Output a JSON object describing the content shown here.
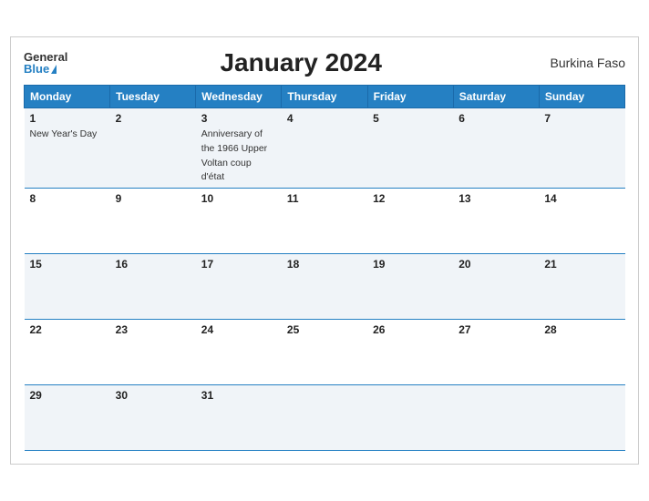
{
  "header": {
    "logo_general": "General",
    "logo_blue": "Blue",
    "month_title": "January 2024",
    "country": "Burkina Faso"
  },
  "days_of_week": [
    "Monday",
    "Tuesday",
    "Wednesday",
    "Thursday",
    "Friday",
    "Saturday",
    "Sunday"
  ],
  "weeks": [
    [
      {
        "day": "1",
        "event": "New Year's Day"
      },
      {
        "day": "2",
        "event": ""
      },
      {
        "day": "3",
        "event": "Anniversary of the 1966 Upper Voltan coup d'état"
      },
      {
        "day": "4",
        "event": ""
      },
      {
        "day": "5",
        "event": ""
      },
      {
        "day": "6",
        "event": ""
      },
      {
        "day": "7",
        "event": ""
      }
    ],
    [
      {
        "day": "8",
        "event": ""
      },
      {
        "day": "9",
        "event": ""
      },
      {
        "day": "10",
        "event": ""
      },
      {
        "day": "11",
        "event": ""
      },
      {
        "day": "12",
        "event": ""
      },
      {
        "day": "13",
        "event": ""
      },
      {
        "day": "14",
        "event": ""
      }
    ],
    [
      {
        "day": "15",
        "event": ""
      },
      {
        "day": "16",
        "event": ""
      },
      {
        "day": "17",
        "event": ""
      },
      {
        "day": "18",
        "event": ""
      },
      {
        "day": "19",
        "event": ""
      },
      {
        "day": "20",
        "event": ""
      },
      {
        "day": "21",
        "event": ""
      }
    ],
    [
      {
        "day": "22",
        "event": ""
      },
      {
        "day": "23",
        "event": ""
      },
      {
        "day": "24",
        "event": ""
      },
      {
        "day": "25",
        "event": ""
      },
      {
        "day": "26",
        "event": ""
      },
      {
        "day": "27",
        "event": ""
      },
      {
        "day": "28",
        "event": ""
      }
    ],
    [
      {
        "day": "29",
        "event": ""
      },
      {
        "day": "30",
        "event": ""
      },
      {
        "day": "31",
        "event": ""
      },
      {
        "day": "",
        "event": ""
      },
      {
        "day": "",
        "event": ""
      },
      {
        "day": "",
        "event": ""
      },
      {
        "day": "",
        "event": ""
      }
    ]
  ]
}
